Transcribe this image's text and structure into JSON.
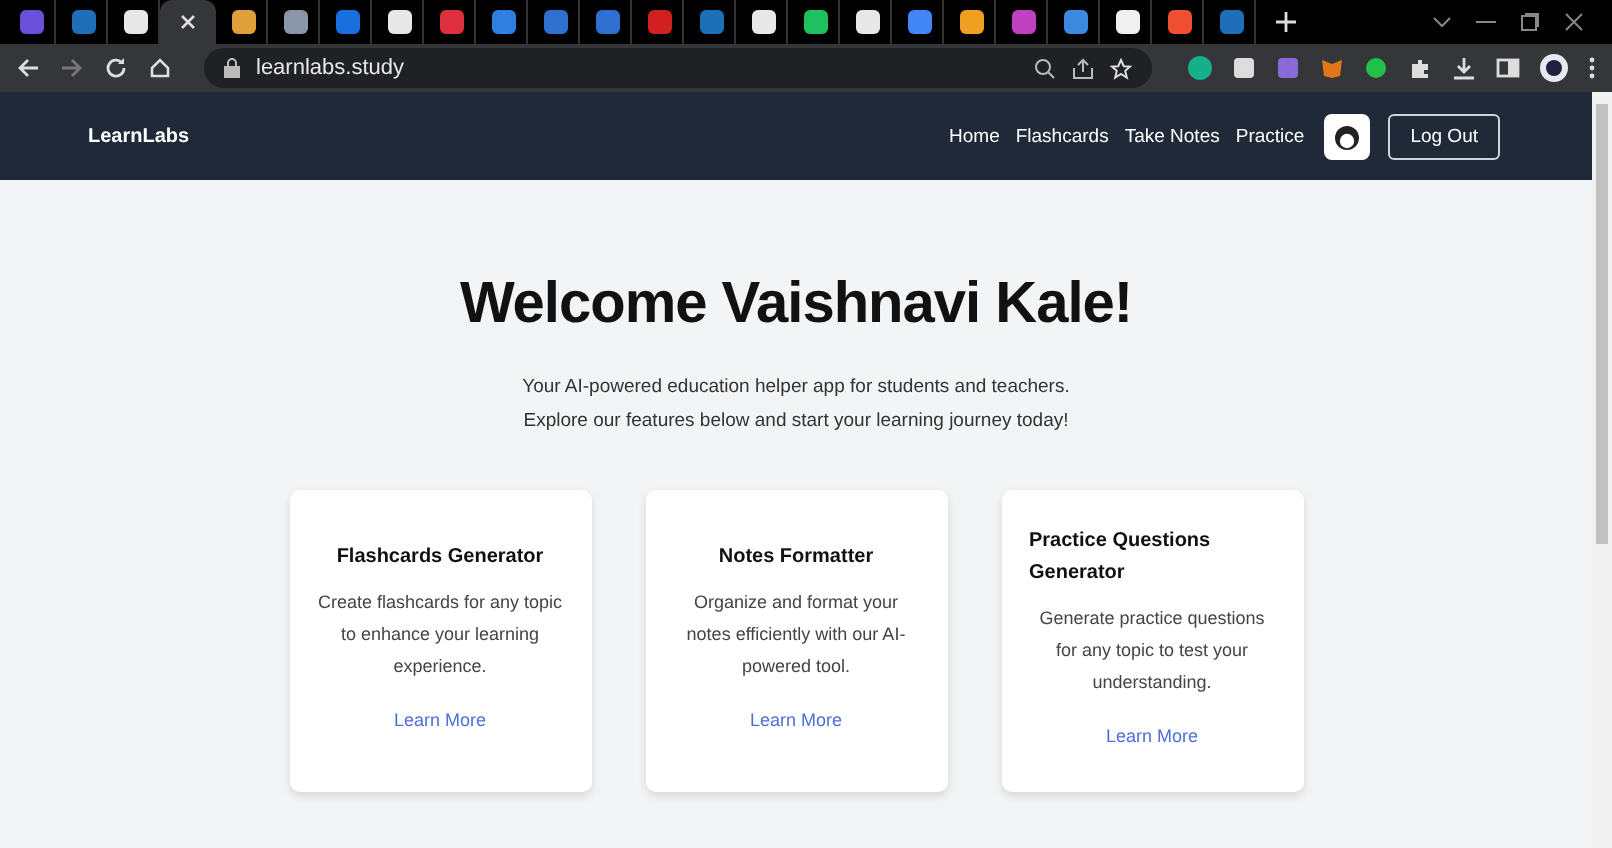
{
  "browser": {
    "tabs": [
      {
        "color": "#6b4fd8",
        "selected": false
      },
      {
        "color": "#1d6fb8",
        "selected": false
      },
      {
        "color": "#e8e8e8",
        "selected": false
      },
      {
        "color": "#3a3a3a",
        "selected": true
      },
      {
        "color": "#e2a03a",
        "selected": false
      },
      {
        "color": "#8a96a8",
        "selected": false
      },
      {
        "color": "#1a6fe0",
        "selected": false
      },
      {
        "color": "#e8e8e8",
        "selected": false
      },
      {
        "color": "#e03040",
        "selected": false
      },
      {
        "color": "#2f7fe0",
        "selected": false
      },
      {
        "color": "#2f6fd0",
        "selected": false
      },
      {
        "color": "#2f6fd0",
        "selected": false
      },
      {
        "color": "#d02020",
        "selected": false
      },
      {
        "color": "#1d6fb8",
        "selected": false
      },
      {
        "color": "#e8e8e8",
        "selected": false
      },
      {
        "color": "#20c060",
        "selected": false
      },
      {
        "color": "#e8e8e8",
        "selected": false
      },
      {
        "color": "#4285f4",
        "selected": false
      },
      {
        "color": "#f0a020",
        "selected": false
      },
      {
        "color": "#c040c0",
        "selected": false
      },
      {
        "color": "#3a8ae0",
        "selected": false
      },
      {
        "color": "#f0f0f0",
        "selected": false
      },
      {
        "color": "#f05030",
        "selected": false
      },
      {
        "color": "#1d6fb8",
        "selected": false
      }
    ],
    "url": "learnlabs.study"
  },
  "nav": {
    "brand": "LearnLabs",
    "links": [
      "Home",
      "Flashcards",
      "Take Notes",
      "Practice"
    ],
    "logout": "Log Out"
  },
  "hero": {
    "title": "Welcome Vaishnavi Kale!",
    "subtitle": "Your AI-powered education helper app for students and teachers. Explore our features below and start your learning journey today!"
  },
  "cards": [
    {
      "title": "Flashcards Generator",
      "text": "Create flashcards for any topic to enhance your learning experience.",
      "link": "Learn More"
    },
    {
      "title": "Notes Formatter",
      "text": "Organize and format your notes efficiently with our AI-powered tool.",
      "link": "Learn More"
    },
    {
      "title": "Practice Questions Generator",
      "text": "Generate practice questions for any topic to test your understanding.",
      "link": "Learn More"
    }
  ]
}
